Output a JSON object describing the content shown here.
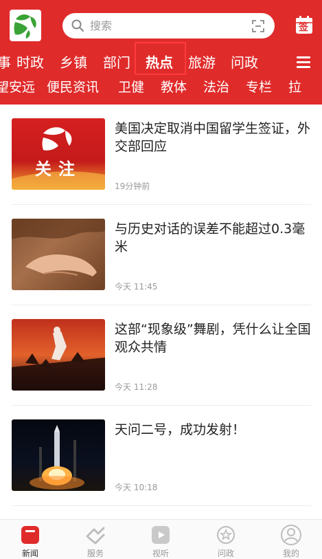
{
  "header": {
    "search_placeholder": "搜索",
    "sign_label": "签"
  },
  "nav_primary": [
    "事",
    "时政",
    "乡镇",
    "部门",
    "热点",
    "旅游",
    "问政"
  ],
  "nav_primary_active": "热点",
  "nav_secondary": [
    "望安远",
    "便民资讯",
    "卫健",
    "教体",
    "法治",
    "专栏",
    "拉"
  ],
  "articles": [
    {
      "title": "美国决定取消中国留学生签证，外交部回应",
      "time": "19分钟前",
      "thumb_text": "关注"
    },
    {
      "title": "与历史对话的误差不能超过0.3毫米",
      "time": "今天 11:45"
    },
    {
      "title": "这部“现象级”舞剧，凭什么让全国观众共情",
      "time": "今天 11:28"
    },
    {
      "title": "天问二号，成功发射！",
      "time": "今天 10:18"
    }
  ],
  "bottom_tabs": [
    {
      "label": "新闻",
      "icon": "news-icon",
      "active": true
    },
    {
      "label": "服务",
      "icon": "service-icon",
      "active": false
    },
    {
      "label": "视听",
      "icon": "video-icon",
      "active": false
    },
    {
      "label": "问政",
      "icon": "inquiry-icon",
      "active": false
    },
    {
      "label": "我的",
      "icon": "profile-icon",
      "active": false
    }
  ],
  "colors": {
    "brand_red": "#e02b2b",
    "logo_green": "#3aa335",
    "text_gray": "#999999"
  }
}
